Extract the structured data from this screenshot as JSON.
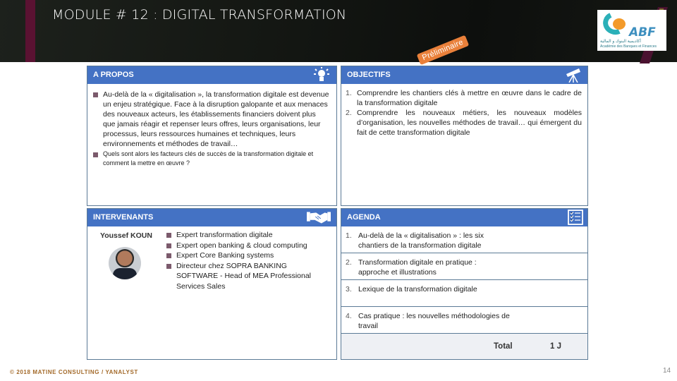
{
  "header": {
    "title": "MODULE # 12 : DIGITAL TRANSFORMATION",
    "stamp": "Préliminaire",
    "logo": {
      "name": "ABF",
      "arabic_line": "أكاديمية البنوك و المالية",
      "french_line": "Académie des Banques et Finances"
    }
  },
  "apropos": {
    "title": "A PROPOS",
    "icon": "lightbulb-icon",
    "items": [
      "Au-delà de la « digitalisation », la transformation digitale est devenue un enjeu stratégique. Face à la disruption galopante et aux menaces des nouveaux acteurs, les établissements financiers doivent plus que jamais réagir et repenser leurs offres, leurs organisations, leur processus, leurs ressources humaines et techniques, leurs environnements et méthodes de travail…",
      "Quels sont alors les facteurs clés de succès de la transformation digitale et comment la mettre en œuvre ?"
    ]
  },
  "objectifs": {
    "title": "OBJECTIFS",
    "icon": "telescope-icon",
    "items": [
      {
        "num": "1.",
        "text": "Comprendre les chantiers clés à mettre en œuvre dans le cadre de la transformation digitale"
      },
      {
        "num": "2.",
        "text": "Comprendre les nouveaux métiers, les nouveaux modèles d’organisation, les nouvelles méthodes de travail… qui émergent du fait de cette transformation digitale"
      }
    ]
  },
  "intervenants": {
    "title": "INTERVENANTS",
    "icon": "handshake-icon",
    "speaker": {
      "name": "Youssef KOUN",
      "roles": [
        "Expert transformation digitale",
        "Expert open banking & cloud computing",
        "Expert Core Banking systems",
        "Directeur chez SOPRA BANKING SOFTWARE - Head of MEA Professional Services Sales"
      ]
    }
  },
  "agenda": {
    "title": "AGENDA",
    "icon": "checklist-icon",
    "items": [
      {
        "num": "1.",
        "text": "Au-delà de la « digitalisation » : les six chantiers de la transformation digitale"
      },
      {
        "num": "2.",
        "text": "Transformation digitale en pratique : approche et illustrations"
      },
      {
        "num": "3.",
        "text": "Lexique de la transformation digitale"
      },
      {
        "num": "4.",
        "text": "Cas pratique : les nouvelles méthodologies de travail"
      }
    ],
    "total_label": "Total",
    "total_value": "1 J"
  },
  "footer": {
    "copyright": "© 2018 MATINE CONSULTING / YANALYST",
    "page_number": "14"
  },
  "colors": {
    "panel_header": "#4472c4",
    "header_bg": "#141713",
    "accent_stripe": "#5a1232",
    "stamp": "#e9803a",
    "bullet": "#7b5a6c"
  }
}
